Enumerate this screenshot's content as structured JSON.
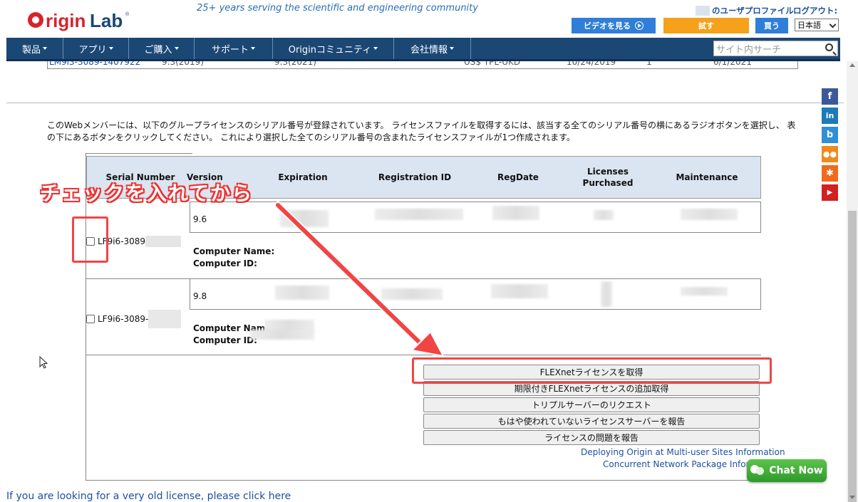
{
  "header": {
    "tagline": "25+ years serving the scientific and engineering community",
    "profile_link": "のユーザプロファイル",
    "logout_link": "ログアウト:",
    "video_button": "ビデオを見る",
    "try_button": "試す",
    "buy_button": "買う",
    "language": "日本語"
  },
  "nav": {
    "items": [
      "製品",
      "アプリ",
      "ご購入",
      "サポート",
      "Originコミュニティ",
      "会社情報"
    ],
    "search_placeholder": "サイト内サーチ"
  },
  "prev_row": {
    "serial": "LM9i3-3089-1407922",
    "version": "9.3(2019)",
    "version2": "9.3(2021)",
    "type": "US$ TPL-UKD",
    "date": "10/24/2019",
    "count": "1",
    "maint": "6/1/2021"
  },
  "intro_text": "このWebメンバーには、以下のグループライセンスのシリアル番号が登録されています。 ライセンスファイルを取得するには、該当する全てのシリアル番号の横にあるラジオボタンを選択し、 表の下にあるボタンをクリックしてください。 これにより選択した全てのシリアル番号の含まれたライセンスファイルが1つ作成されます。",
  "table": {
    "headers": {
      "serial": "Serial Number",
      "version": "Version",
      "expiration": "Expiration",
      "registration_id": "Registration ID",
      "regdate": "RegDate",
      "licenses_purchased": "Licenses Purchased",
      "maintenance": "Maintenance"
    },
    "rows": [
      {
        "serial": "LF9i6-3089",
        "version": "9.6",
        "computer_name_label": "Computer Name:",
        "computer_id_label": "Computer ID:"
      },
      {
        "serial": "LF9i6-3089-",
        "version": "9.8",
        "computer_name_label": "Computer Name:",
        "computer_id_label": "Computer ID:"
      }
    ]
  },
  "actions": {
    "get_flexnet": "FLEXnetライセンスを取得",
    "get_time_limited": "期限付きFLEXnetライセンスの追加取得",
    "triple_server": "トリプルサーバーのリクエスト",
    "report_unused": "もはや使われていないライセンスサーバーを報告",
    "report_problem": "ライセンスの問題を報告",
    "deploying_link": "Deploying Origin at Multi-user Sites Information",
    "concurrent_link": "Concurrent Network Package Informat"
  },
  "old_license_link": "If you are looking for a very old license, please click here",
  "annotation_text": "チェックを入れてから",
  "chat_now": "Chat Now",
  "social": [
    "facebook",
    "linkedin",
    "blog",
    "community",
    "rss",
    "youtube"
  ],
  "colors": {
    "nav_bg": "#1b4775",
    "accent_blue": "#2f7ed8",
    "accent_orange": "#f5a11c",
    "annotation_red": "#f04545",
    "table_header_bg": "#dbe5f1"
  }
}
